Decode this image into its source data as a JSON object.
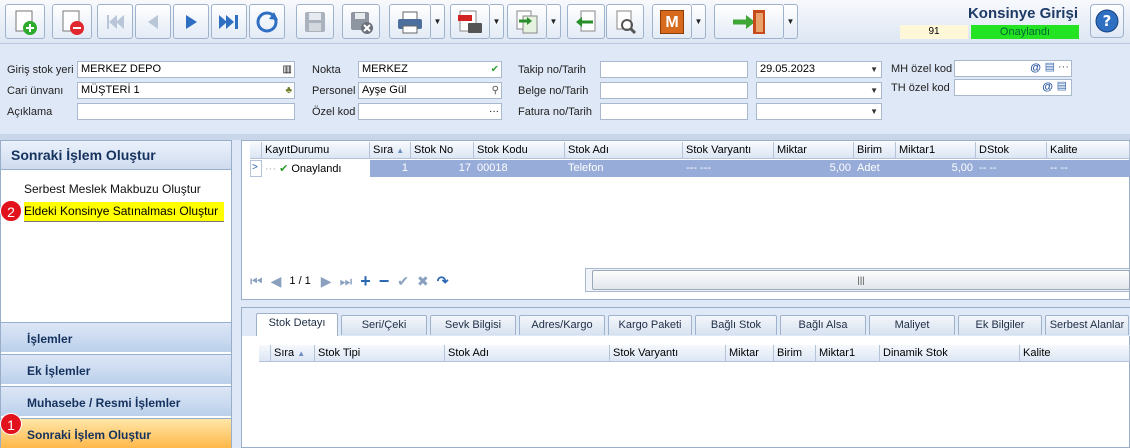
{
  "header": {
    "form_title": "Konsinye Girişi",
    "record_no": "91",
    "status": "Onaylandı"
  },
  "toolbar": {
    "buttons": [
      "new-icon",
      "delete-icon",
      "first-icon",
      "prev-icon",
      "next-icon",
      "last-icon",
      "refresh-icon",
      "save-icon",
      "save-close-icon",
      "print-icon",
      "pdf-icon",
      "export-icon",
      "import-icon",
      "tools-icon",
      "m-icon",
      "exit-icon"
    ],
    "m_letter": "M"
  },
  "form": {
    "giris_stok_yeri_label": "Giriş stok yeri",
    "giris_stok_yeri": "MERKEZ DEPO",
    "cari_unvani_label": "Cari ünvanı",
    "cari_unvani": "MÜŞTERİ 1",
    "aciklama_label": "Açıklama",
    "aciklama": "",
    "nokta_label": "Nokta",
    "nokta": "MERKEZ",
    "personel_label": "Personel",
    "personel": "Ayşe Gül",
    "ozel_kod_label": "Özel kod",
    "ozel_kod": "",
    "ozel_kod_btn": "···",
    "takip_label": "Takip no/Tarih",
    "takip_no": "",
    "takip_tarih": "29.05.2023",
    "belge_label": "Belge no/Tarih",
    "belge_no": "",
    "belge_tarih": "",
    "fatura_label": "Fatura no/Tarih",
    "fatura_no": "",
    "fatura_tarih": "",
    "mh_ozel_kod_label": "MH özel kod",
    "th_ozel_kod_label": "TH özel kod",
    "at_symbol": "@",
    "ellipsis": "···"
  },
  "left_panel": {
    "title": "Sonraki İşlem Oluştur",
    "links": [
      "Serbest Meslek Makbuzu Oluştur",
      "Eldeki Konsinye Satınalması Oluştur"
    ],
    "badge_1": "1",
    "badge_2": "2",
    "nav": [
      "İşlemler",
      "Ek İşlemler",
      "Muhasebe / Resmi İşlemler",
      "Sonraki İşlem Oluştur"
    ]
  },
  "grid": {
    "columns": [
      "KayıtDurumu",
      "Sıra",
      "Stok No",
      "Stok Kodu",
      "Stok Adı",
      "Stok Varyantı",
      "Miktar",
      "Birim",
      "Miktar1",
      "DStok",
      "Kalite"
    ],
    "row": {
      "kayit_durumu": "Onaylandı",
      "sira": "1",
      "stok_no": "17",
      "stok_kodu": "00018",
      "stok_adi": "Telefon",
      "stok_varyanti": "--- ---",
      "miktar": "5,00",
      "birim": "Adet",
      "miktar1": "5,00",
      "dstok": "-- --",
      "kalite": "-- --"
    },
    "pager": "1 / 1",
    "scroll_grip": "|||"
  },
  "detail": {
    "tabs": [
      "Stok Detayı",
      "Seri/Çeki",
      "Sevk Bilgisi",
      "Adres/Kargo",
      "Kargo Paketi",
      "Bağlı Stok",
      "Bağlı Alsa",
      "Maliyet",
      "Ek Bilgiler",
      "Serbest Alanlar"
    ],
    "columns": [
      "Sıra",
      "Stok Tipi",
      "Stok Adı",
      "Stok Varyantı",
      "Miktar",
      "Birim",
      "Miktar1",
      "Dinamik Stok",
      "Kalite"
    ]
  },
  "colors": {
    "status_green": "#23e323",
    "highlight_yellow": "#ffff00",
    "badge_red": "#e2121c",
    "selected_row": "#97acd9"
  }
}
